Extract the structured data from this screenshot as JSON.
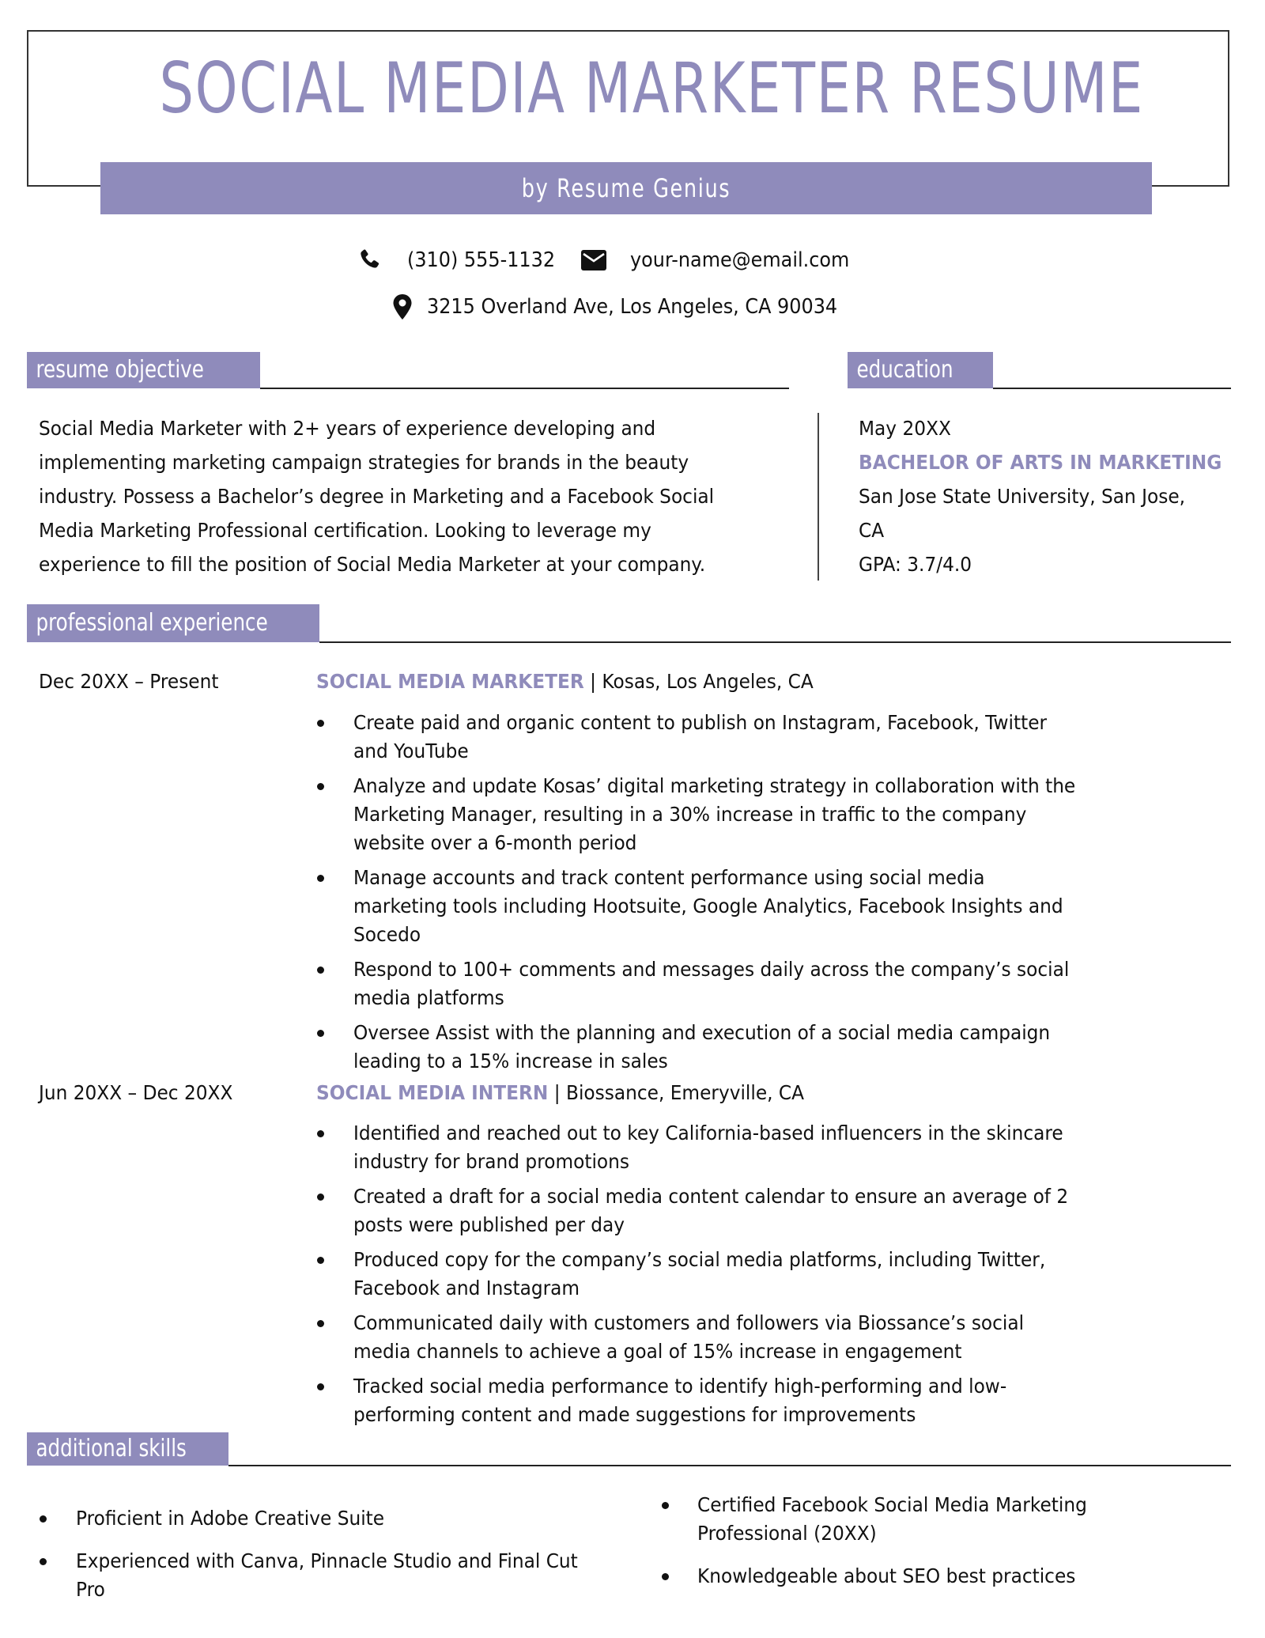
{
  "header": {
    "title": "SOCIAL MEDIA MARKETER RESUME",
    "byline": "by Resume Genius"
  },
  "contact": {
    "phone": {
      "icon": "phone-icon",
      "value": "(310) 555-1132"
    },
    "email": {
      "icon": "envelope-icon",
      "value": "your-name@email.com"
    },
    "address": {
      "icon": "map-pin-icon",
      "value": "3215 Overland Ave, Los Angeles, CA 90034"
    }
  },
  "colors": {
    "accent": "#8f8bbb",
    "text": "#111111",
    "rule": "#222222"
  },
  "objective": {
    "heading": "resume objective",
    "lines": [
      "Social Media Marketer with 2+ years of experience developing and",
      "implementing marketing campaign strategies for brands in the beauty",
      "industry. Possess a Bachelor’s degree in Marketing and a Facebook Social",
      "Media Marketing Professional certification. Looking to leverage my",
      "experience to fill the position of Social Media Marketer at your company."
    ]
  },
  "education": {
    "heading": "education",
    "date": "May 20XX",
    "degree": "BACHELOR OF ARTS IN MARKETING",
    "school_line1": "San Jose State University, San Jose,",
    "school_line2": "CA",
    "gpa": "GPA: 3.7/4.0"
  },
  "experience": {
    "heading": "professional experience",
    "jobs": [
      {
        "dates": "Dec 20XX – Present",
        "title": "SOCIAL MEDIA MARKETER",
        "separator": " | ",
        "company": "Kosas, Los Angeles, CA",
        "bullets": [
          [
            "Create paid and organic content to publish on Instagram, Facebook, Twitter",
            "and YouTube"
          ],
          [
            "Analyze and update Kosas’ digital marketing strategy in collaboration with the",
            "Marketing Manager, resulting in a 30% increase in traffic to the company",
            "website over a 6-month period"
          ],
          [
            "Manage accounts and track content performance using social media",
            "marketing tools including Hootsuite, Google Analytics, Facebook Insights and",
            "Socedo"
          ],
          [
            "Respond to 100+ comments and messages daily across the company’s social",
            "media platforms"
          ],
          [
            "Oversee Assist with the planning and execution of a social media campaign",
            "leading to a 15% increase in sales"
          ]
        ]
      },
      {
        "dates": "Jun 20XX – Dec 20XX",
        "title": "SOCIAL MEDIA INTERN",
        "separator": " | ",
        "company": "Biossance, Emeryville, CA",
        "bullets": [
          [
            "Identified and reached out to key California-based influencers in the skincare",
            "industry for brand promotions"
          ],
          [
            "Created a draft for a social media content calendar to ensure an average of 2",
            "posts were published per day"
          ],
          [
            "Produced copy for the company’s social media platforms, including Twitter,",
            "Facebook and Instagram"
          ],
          [
            "Communicated daily with customers and followers via Biossance’s social",
            "media channels to achieve a goal of 15% increase in engagement"
          ],
          [
            "Tracked social media performance to identify high-performing and low-",
            "performing content and made suggestions for improvements"
          ]
        ]
      }
    ]
  },
  "skills": {
    "heading": "additional skills",
    "left": [
      [
        "Proficient in Adobe Creative Suite"
      ],
      [
        "Experienced with Canva, Pinnacle Studio and Final Cut",
        "Pro"
      ]
    ],
    "right": [
      [
        "Certified Facebook Social Media Marketing",
        "Professional (20XX)"
      ],
      [
        "Knowledgeable about SEO best practices"
      ]
    ]
  }
}
